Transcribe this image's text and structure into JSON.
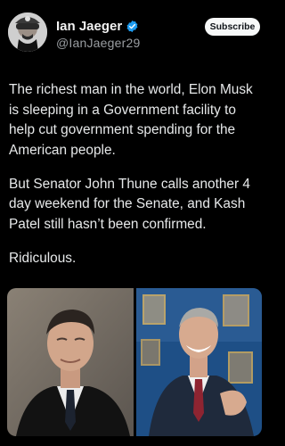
{
  "author": {
    "display_name": "Ian Jaeger",
    "handle": "@IanJaeger29",
    "avatar_icon": "avatar-photo",
    "verified_icon": "verified-badge-icon",
    "verified_color": "#1d9bf0"
  },
  "actions": {
    "subscribe_label": "Subscribe"
  },
  "tweet": {
    "paragraphs": [
      "The richest man in the world, Elon Musk is sleeping in a Government facility to help cut government spending for the American people.",
      "But Senator John Thune calls another 4 day weekend for the Senate, and Kash Patel still hasn’t been confirmed.",
      "Ridiculous."
    ]
  },
  "media": {
    "count": 2,
    "photos": [
      {
        "subject": "photo-left"
      },
      {
        "subject": "photo-right"
      }
    ]
  },
  "colors": {
    "background": "#000000",
    "text": "#e7e9ea",
    "handle": "#9a9ea2",
    "accent": "#1d9bf0"
  }
}
